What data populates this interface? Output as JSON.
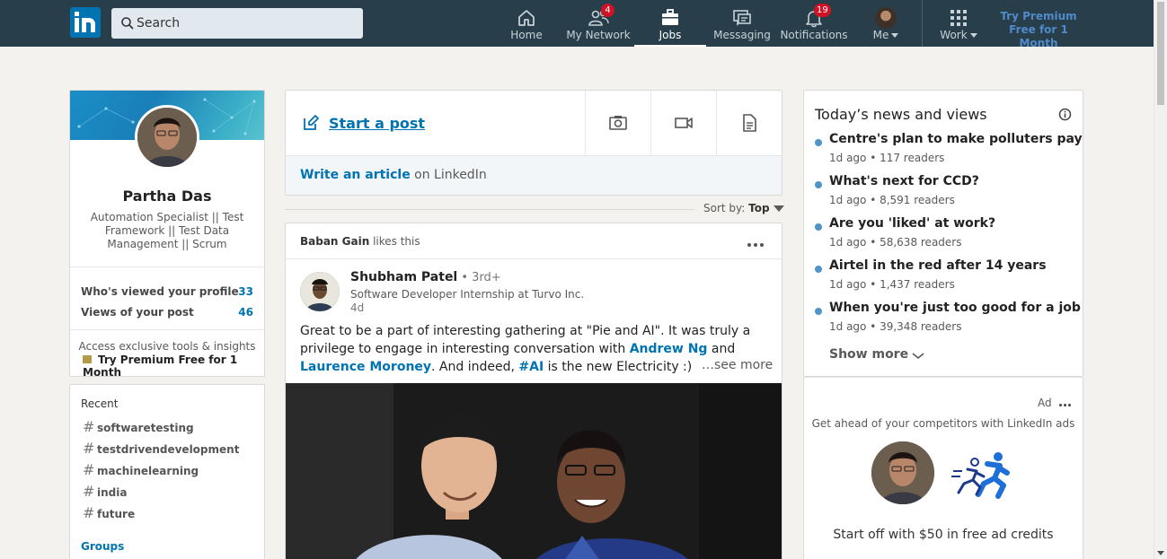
{
  "nav": {
    "logo": "in",
    "search_placeholder": "Search",
    "items": [
      {
        "label": "Home",
        "icon": "home-icon"
      },
      {
        "label": "My Network",
        "icon": "network-icon",
        "badge": "4"
      },
      {
        "label": "Jobs",
        "icon": "briefcase-icon",
        "active": true
      },
      {
        "label": "Messaging",
        "icon": "messaging-icon"
      },
      {
        "label": "Notifications",
        "icon": "bell-icon",
        "badge": "19"
      },
      {
        "label": "Me",
        "icon": "avatar"
      },
      {
        "label": "Work",
        "icon": "grid-icon"
      }
    ],
    "premium_line1": "Try Premium",
    "premium_line2": "Free for 1 Month"
  },
  "profile": {
    "name": "Partha Das",
    "headline": "Automation Specialist || Test Framework || Test Data Management || Scrum",
    "stats": [
      {
        "label": "Who's viewed your profile",
        "value": "33"
      },
      {
        "label": "Views of your post",
        "value": "46"
      }
    ],
    "access_text": "Access exclusive tools & insights",
    "premium_cta": "Try Premium Free for 1 Month"
  },
  "recent": {
    "title": "Recent",
    "tags": [
      "softwaretesting",
      "testdrivendevelopment",
      "machinelearning",
      "india",
      "future"
    ],
    "groups_label": "Groups"
  },
  "share": {
    "start_post": "Start a post",
    "write_article_link": "Write an article",
    "write_article_suffix": " on LinkedIn"
  },
  "sort": {
    "label": "Sort by:",
    "value": "Top"
  },
  "post": {
    "actor_name": "Baban Gain",
    "actor_action": " likes this",
    "author_name": "Shubham Patel",
    "author_degree": " • 3rd+",
    "author_headline": "Software Developer Internship at Turvo Inc.",
    "time": "4d",
    "body_part1": "Great to be a part of interesting gathering at \"Pie and AI\". It was truly a privilege to engage in interesting conversation with ",
    "mention1": "Andrew Ng",
    "body_part2": " and ",
    "mention2": "Laurence Moroney",
    "body_part3": ". And indeed, ",
    "hashtag": "#AI",
    "body_part4": " is the new Electricity :)",
    "see_more": "…see more"
  },
  "news": {
    "title": "Today’s news and views",
    "items": [
      {
        "headline": "Centre's plan to make polluters pay",
        "meta": "1d ago • 117 readers"
      },
      {
        "headline": "What's next for CCD?",
        "meta": "1d ago • 8,591 readers"
      },
      {
        "headline": "Are you 'liked' at work?",
        "meta": "1d ago • 58,638 readers"
      },
      {
        "headline": "Airtel in the red after 14 years",
        "meta": "1d ago • 1,437 readers"
      },
      {
        "headline": "When you're just too good for a job",
        "meta": "1d ago • 39,348 readers"
      }
    ],
    "show_more": "Show more"
  },
  "ad": {
    "label": "Ad",
    "tagline": "Get ahead of your competitors with LinkedIn ads",
    "offer": "Start off with $50 in free ad credits"
  },
  "colors": {
    "nav_bg": "#283e4a",
    "brand_blue": "#0073b1",
    "badge_red": "#d11124",
    "page_bg": "#f3f2ef"
  }
}
